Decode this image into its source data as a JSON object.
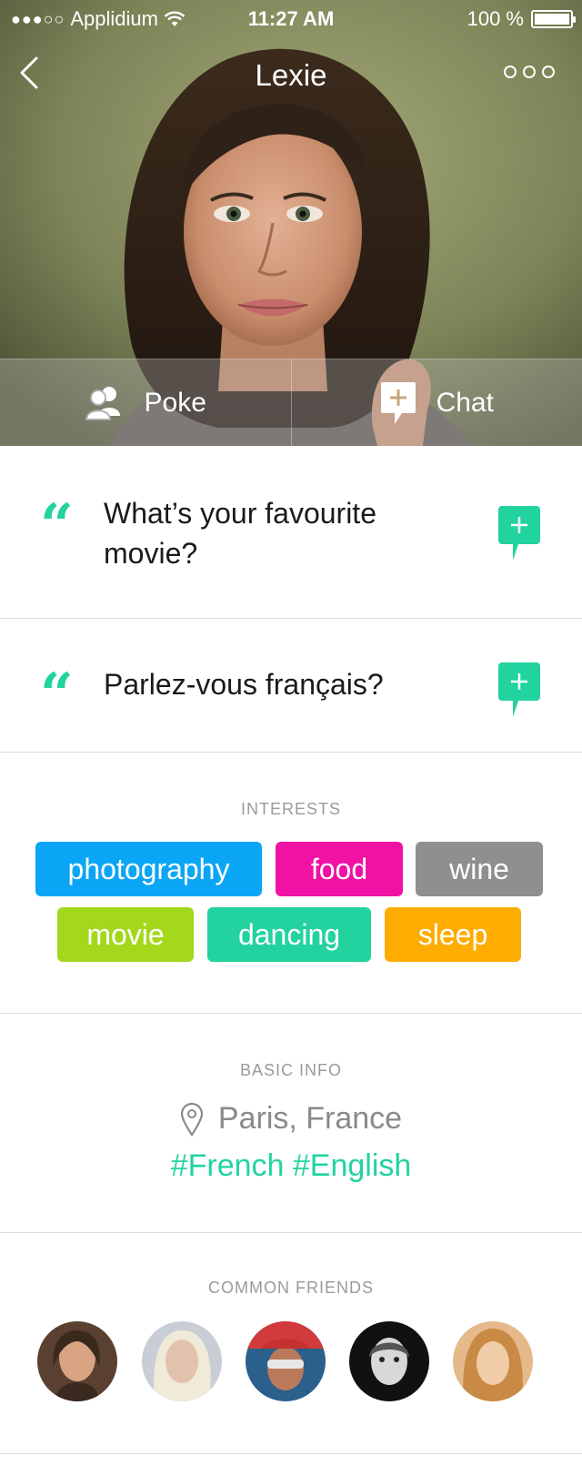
{
  "status_bar": {
    "signal": "●●●○○",
    "carrier": "Applidium",
    "time": "11:27 AM",
    "battery_text": "100 %",
    "battery_level": 1.0
  },
  "nav": {
    "title": "Lexie"
  },
  "actions": {
    "poke_label": "Poke",
    "chat_label": "Chat"
  },
  "questions": [
    {
      "text": "What’s your favourite movie?"
    },
    {
      "text": "Parlez-vous français?"
    }
  ],
  "interests": {
    "label": "INTERESTS",
    "tags": [
      {
        "label": "photography",
        "color": "#0aa6f5"
      },
      {
        "label": "food",
        "color": "#f012a4"
      },
      {
        "label": "wine",
        "color": "#8f8f8f"
      },
      {
        "label": "movie",
        "color": "#a3d81c"
      },
      {
        "label": "dancing",
        "color": "#22d3a0"
      },
      {
        "label": "sleep",
        "color": "#ffac00"
      }
    ]
  },
  "basic_info": {
    "label": "BASIC INFO",
    "location": "Paris, France",
    "languages": "#French #English"
  },
  "common_friends": {
    "label": "COMMON FRIENDS",
    "count": 5
  },
  "colors": {
    "accent": "#22d3a0",
    "divider": "#dcdcdc",
    "label_gray": "#9a9a9a"
  }
}
